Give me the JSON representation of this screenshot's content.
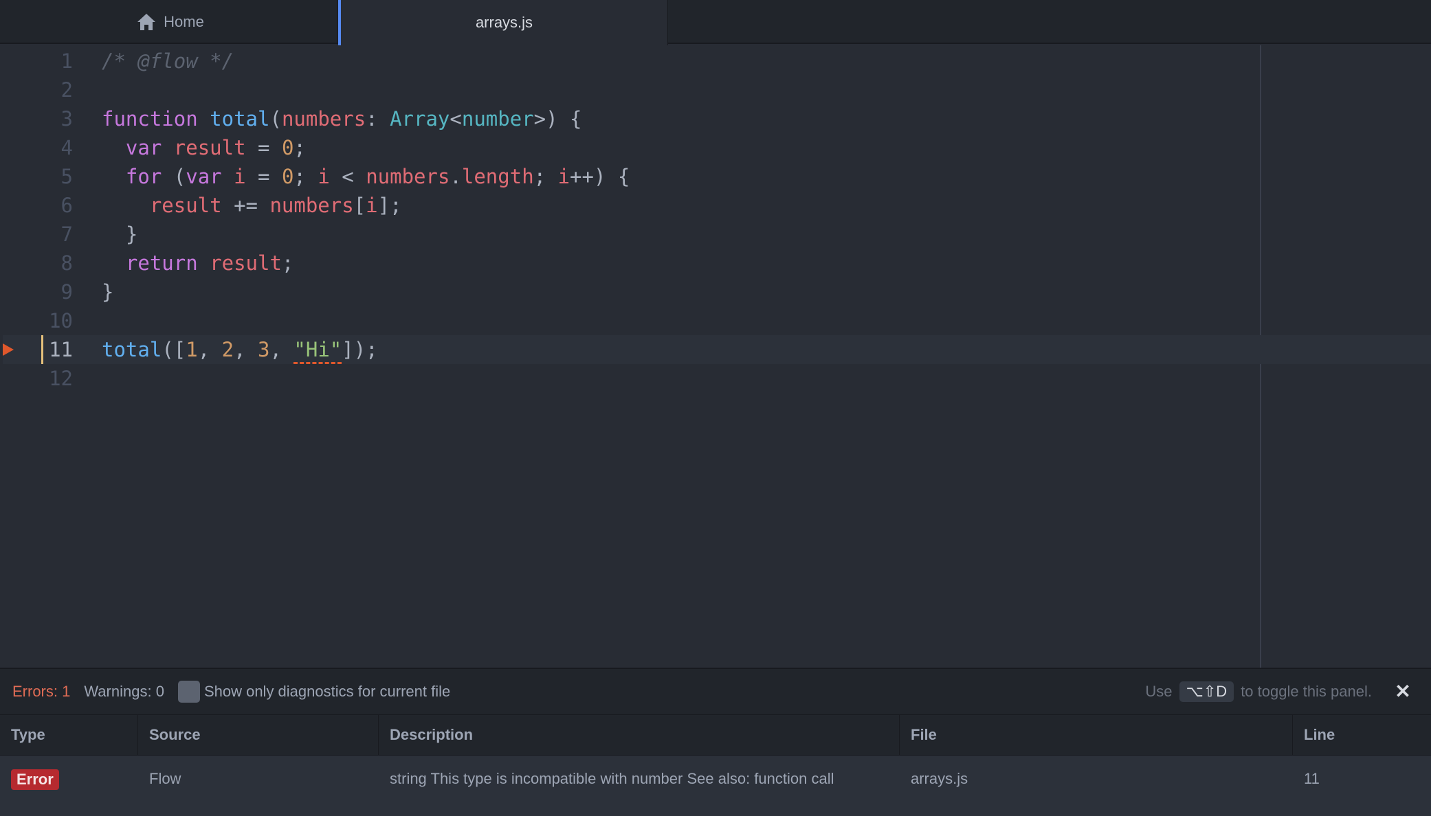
{
  "tabs": [
    {
      "label": "Home",
      "icon": "home-icon",
      "active": false
    },
    {
      "label": "arrays.js",
      "active": true
    }
  ],
  "editor": {
    "cursor_line": 11,
    "lines": [
      {
        "num": "1"
      },
      {
        "num": "2"
      },
      {
        "num": "3"
      },
      {
        "num": "4"
      },
      {
        "num": "5"
      },
      {
        "num": "6"
      },
      {
        "num": "7"
      },
      {
        "num": "8"
      },
      {
        "num": "9"
      },
      {
        "num": "10"
      },
      {
        "num": "11"
      },
      {
        "num": "12"
      }
    ],
    "tokens": {
      "l1": "/* @flow */",
      "l3_kw": "function",
      "l3_fn": "total",
      "l3_p1": "(",
      "l3_param": "numbers",
      "l3_colon": ": ",
      "l3_type": "Array",
      "l3_lt": "<",
      "l3_type2": "number",
      "l3_end": ">) {",
      "l4_kw": "var",
      "l4_var": "result",
      "l4_eq": " = ",
      "l4_num": "0",
      "l4_semi": ";",
      "l5_kw": "for",
      "l5_p": " (",
      "l5_kw2": "var",
      "l5_i": "i",
      "l5_eq": " = ",
      "l5_num": "0",
      "l5_semi": "; ",
      "l5_i2": "i",
      "l5_lt": " < ",
      "l5_arr": "numbers",
      "l5_dot": ".",
      "l5_len": "length",
      "l5_semi2": "; ",
      "l5_i3": "i",
      "l5_end": "++) {",
      "l6_var": "result",
      "l6_op": " += ",
      "l6_arr": "numbers",
      "l6_b1": "[",
      "l6_i": "i",
      "l6_b2": "];",
      "l7": "}",
      "l8_kw": "return",
      "l8_var": "result",
      "l8_semi": ";",
      "l9": "}",
      "l11_fn": "total",
      "l11_p": "([",
      "l11_n1": "1",
      "l11_c1": ", ",
      "l11_n2": "2",
      "l11_c2": ", ",
      "l11_n3": "3",
      "l11_c3": ", ",
      "l11_str": "\"Hi\"",
      "l11_end": "]);"
    }
  },
  "diagnostics": {
    "errors_label": "Errors: 1",
    "warnings_label": "Warnings: 0",
    "filter_label": "Show only diagnostics for current file",
    "hint_prefix": "Use",
    "hint_keys": "⌥⇧D",
    "hint_suffix": "to toggle this panel.",
    "close_glyph": "✕",
    "columns": [
      "Type",
      "Source",
      "Description",
      "File",
      "Line"
    ],
    "rows": [
      {
        "type": "Error",
        "source": "Flow",
        "description": "string This type is incompatible with number See also: function call",
        "file": "arrays.js",
        "line": "11"
      }
    ]
  },
  "colors": {
    "background": "#282c34",
    "accent": "#568af2",
    "error": "#e06c55",
    "error_badge": "#b62a2f"
  }
}
